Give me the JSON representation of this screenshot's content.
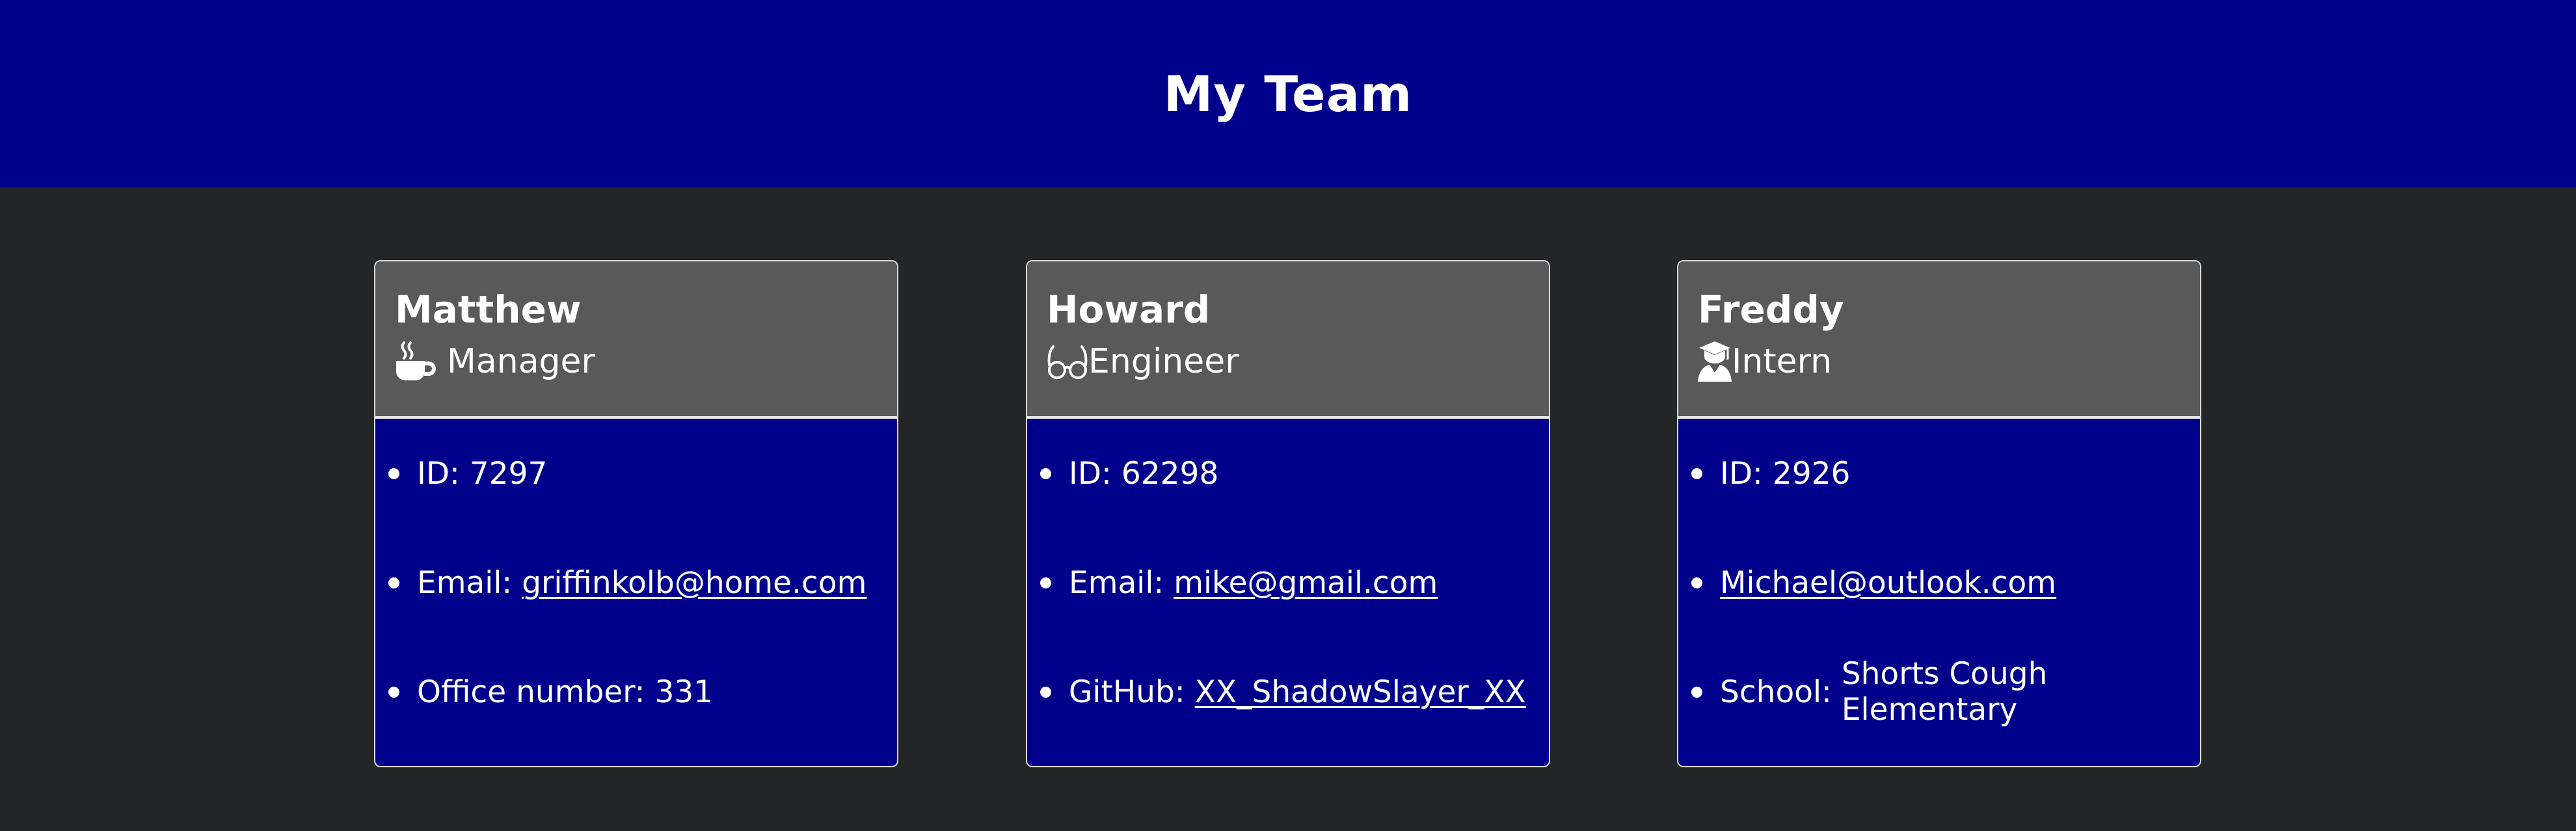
{
  "page": {
    "title": "My Team",
    "colors": {
      "header_bg": "#00008b",
      "page_bg": "#242526",
      "card_head_bg": "#595959",
      "card_body_bg": "#00008b",
      "text": "#ffffff"
    }
  },
  "cards": [
    {
      "name": "Matthew",
      "role": "Manager",
      "role_icon": "coffee-icon",
      "id_label": "ID: ",
      "id_value": "7297",
      "email_label": "Email: ",
      "email": "griffinkolb@home.com",
      "extra_label": "Office number: ",
      "extra_value": "331"
    },
    {
      "name": "Howard",
      "role": "Engineer",
      "role_icon": "glasses-icon",
      "id_label": "ID: ",
      "id_value": "62298",
      "email_label": "Email: ",
      "email": "mike@gmail.com",
      "extra_label": "GitHub: ",
      "extra_value": "XX_ShadowSlayer_XX"
    },
    {
      "name": "Freddy",
      "role": "Intern",
      "role_icon": "graduate-icon",
      "id_label": "ID: ",
      "id_value": "2926",
      "email": "Michael@outlook.com",
      "extra_label": "School: ",
      "extra_value": "Shorts Cough Elementary"
    }
  ]
}
